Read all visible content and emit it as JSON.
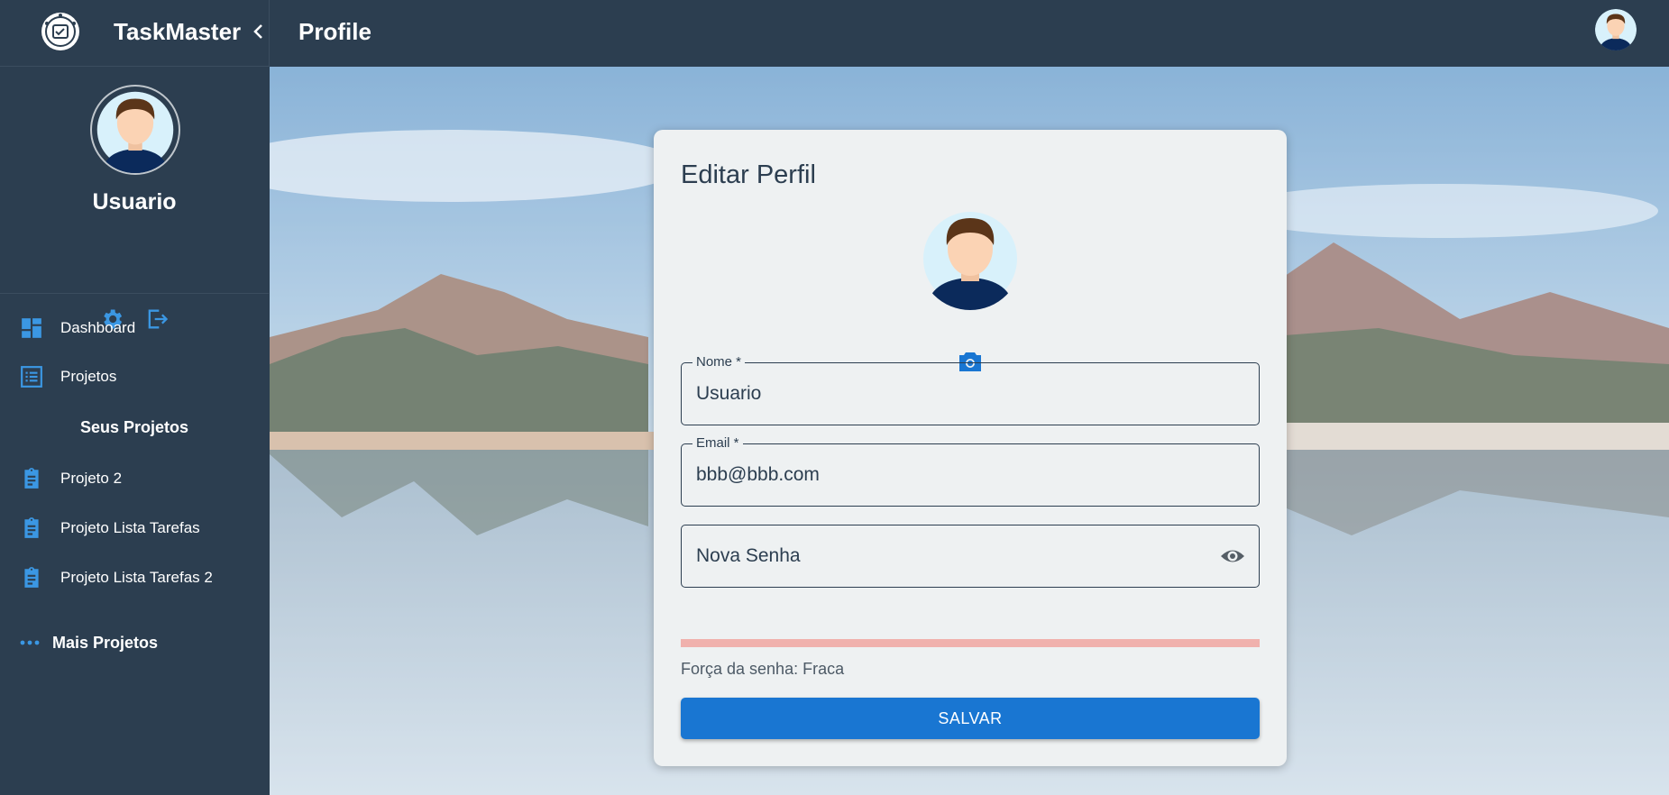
{
  "app": {
    "name": "TaskMaster"
  },
  "colors": {
    "accent": "#1976d2",
    "sidebar_bg": "#2c3e50",
    "icon_blue": "#3b97e3",
    "strength_weak": "#f0b1ad"
  },
  "header": {
    "title": "Profile"
  },
  "sidebar": {
    "username": "Usuario",
    "icons": [
      "settings-icon",
      "logout-icon"
    ],
    "nav": [
      {
        "label": "Dashboard",
        "icon": "dashboard-icon"
      },
      {
        "label": "Projetos",
        "icon": "list-icon"
      }
    ],
    "projects_heading": "Seus Projetos",
    "projects": [
      {
        "label": "Projeto 2",
        "icon": "clipboard-icon"
      },
      {
        "label": "Projeto Lista Tarefas",
        "icon": "clipboard-icon"
      },
      {
        "label": "Projeto Lista Tarefas 2",
        "icon": "clipboard-icon"
      }
    ],
    "more_label": "Mais Projetos"
  },
  "profile_form": {
    "title": "Editar Perfil",
    "name_label": "Nome *",
    "name_value": "Usuario",
    "email_label": "Email *",
    "email_value": "bbb@bbb.com",
    "password_placeholder": "Nova Senha",
    "password_strength_text": "Força da senha: Fraca",
    "password_strength_fraction": 0.0,
    "save_label": "SALVAR"
  }
}
